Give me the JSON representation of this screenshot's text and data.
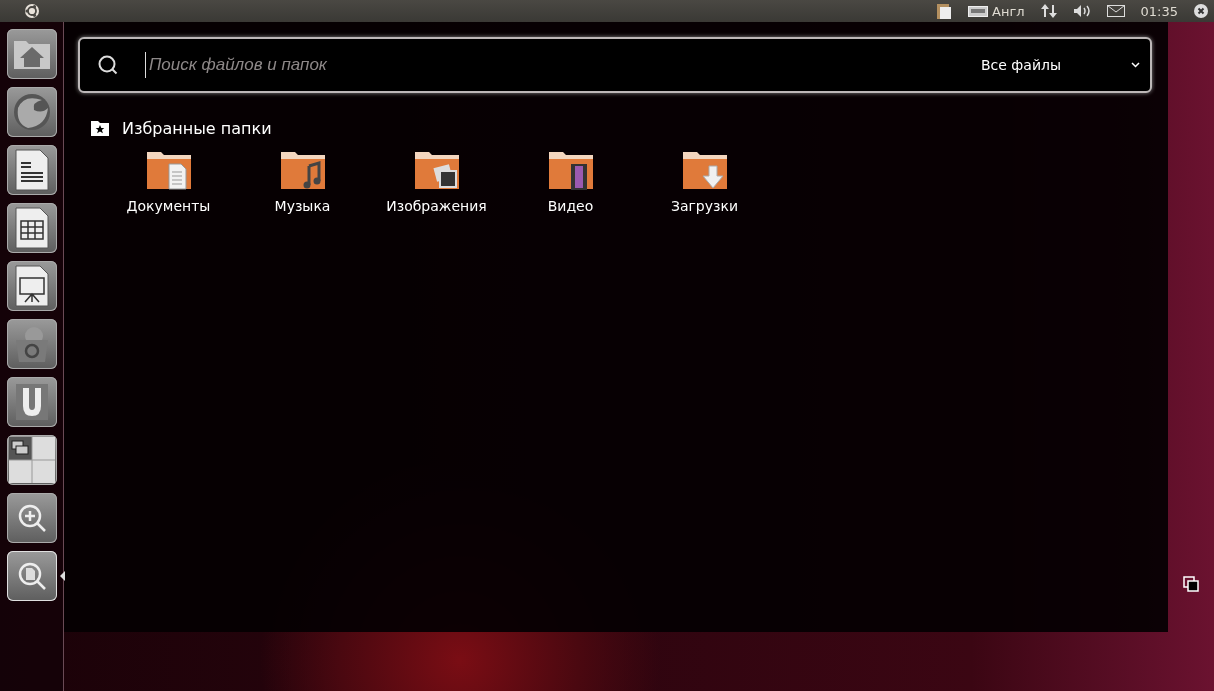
{
  "top_panel": {
    "indicators": [
      {
        "kind": "clipboard"
      },
      {
        "kind": "keyboard",
        "label": "Англ"
      },
      {
        "kind": "network"
      },
      {
        "kind": "volume"
      },
      {
        "kind": "mail"
      },
      {
        "kind": "clock",
        "label": "01:35"
      },
      {
        "kind": "power"
      }
    ]
  },
  "launcher": {
    "items": [
      {
        "kind": "home"
      },
      {
        "kind": "browser"
      },
      {
        "kind": "writer"
      },
      {
        "kind": "calc"
      },
      {
        "kind": "impress"
      },
      {
        "kind": "software"
      },
      {
        "kind": "ubuntuone"
      },
      {
        "kind": "workspaces"
      },
      {
        "kind": "apps"
      },
      {
        "kind": "files",
        "selected": true
      }
    ]
  },
  "search": {
    "placeholder": "Поиск файлов и папок",
    "filter": "Все файлы"
  },
  "section": {
    "title": "Избранные папки"
  },
  "folders": [
    {
      "name": "Документы",
      "kind": "document"
    },
    {
      "name": "Музыка",
      "kind": "music"
    },
    {
      "name": "Изображения",
      "kind": "picture"
    },
    {
      "name": "Видео",
      "kind": "video"
    },
    {
      "name": "Загрузки",
      "kind": "download"
    }
  ]
}
